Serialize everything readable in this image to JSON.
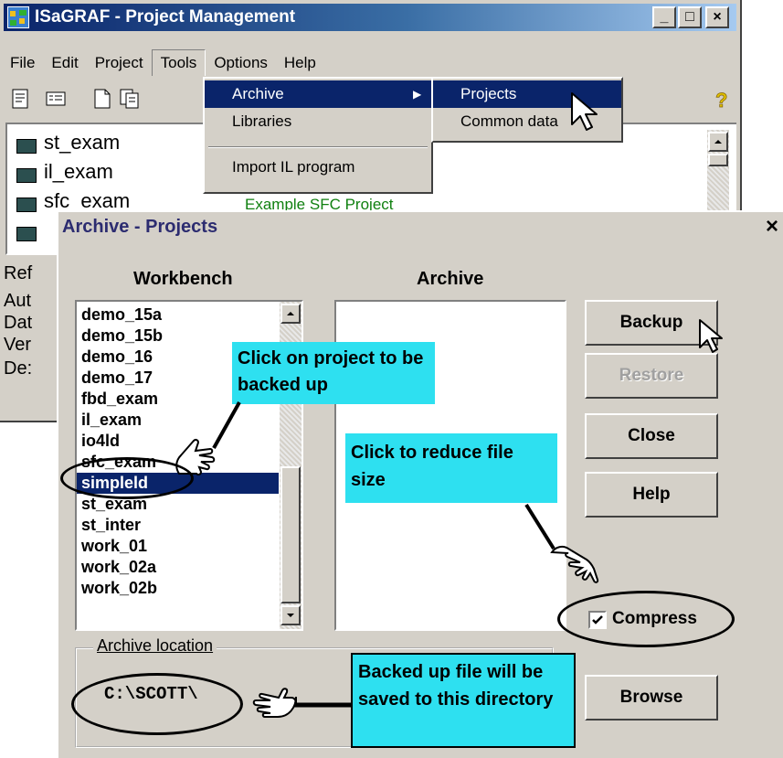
{
  "colors": {
    "titlebar": "#0a246a",
    "selection": "#0a246a",
    "callout": "#2ee0f0",
    "window": "#d4d0c8"
  },
  "main_window": {
    "title": "ISaGRAF - Project Management",
    "menu": [
      "File",
      "Edit",
      "Project",
      "Tools",
      "Options",
      "Help"
    ],
    "projects": [
      {
        "name": "st_exam",
        "desc": ""
      },
      {
        "name": "il_exam",
        "desc": ""
      },
      {
        "name": "sfc_exam",
        "desc": "Example SFC Project"
      }
    ],
    "info_labels": [
      "Ref",
      "Aut",
      "Dat",
      "Ver",
      "De:"
    ]
  },
  "tools_menu": {
    "items": [
      "Archive",
      "Libraries",
      "Import IL program"
    ]
  },
  "archive_submenu": {
    "items": [
      "Projects",
      "Common data"
    ]
  },
  "dialog": {
    "title": "Archive - Projects",
    "workbench_label": "Workbench",
    "archive_label": "Archive",
    "workbench_items": [
      "demo_15a",
      "demo_15b",
      "demo_16",
      "demo_17",
      "fbd_exam",
      "il_exam",
      "io4ld",
      "sfc_exam",
      "simpleld",
      "st_exam",
      "st_inter",
      "work_01",
      "work_02a",
      "work_02b"
    ],
    "selected_item": "simpleld",
    "buttons": {
      "backup": "Backup",
      "restore": "Restore",
      "close": "Close",
      "help": "Help",
      "browse": "Browse"
    },
    "compress_label": "Compress",
    "compress_checked": true,
    "location_group": "Archive location",
    "location_value": "C:\\SCOTT\\"
  },
  "callouts": {
    "project": "Click on project to be backed up",
    "compress": "Click to reduce file size",
    "location": "Backed up file will be saved to this directory"
  },
  "icons": [
    "app-icon",
    "minimize-icon",
    "maximize-icon",
    "close-icon",
    "project-icon",
    "help-icon",
    "pointer-hand-icon",
    "arrow-cursor-icon",
    "check-icon"
  ]
}
